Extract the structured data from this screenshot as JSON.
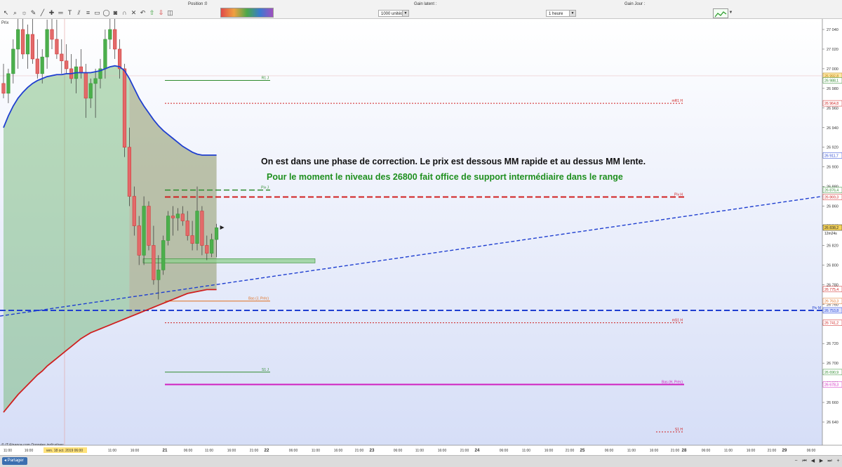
{
  "toolbar": {
    "position_label": "Position :",
    "position_value": "0",
    "latent_label": "Gain latent :",
    "gain_day_label": "Gain Jour :",
    "units_value": "1000 unités",
    "timeframe_value": "1 heure",
    "prix_label": "Prix"
  },
  "annotations": {
    "line1": "On est dans une phase de correction. Le prix est dessous MM rapide et au dessus MM lente.",
    "line2": "Pour le moment le niveau des 26800 fait office de support intermédiaire dans le range"
  },
  "copyright": "© IT-Finance.com Données indicatives",
  "status": {
    "share_label": "Partager"
  },
  "chart_data": {
    "type": "candlestick",
    "timeframe": "1 heure",
    "instrument_price": 26838.2,
    "timer": "12m24s",
    "y_axis": {
      "min": 26630,
      "max": 27050,
      "ticks": [
        27040,
        27020,
        27000,
        26980,
        26960,
        26940,
        26920,
        26900,
        26880,
        26860,
        26840,
        26820,
        26800,
        26780,
        26760,
        26740,
        26720,
        26700,
        26680,
        26660,
        26640
      ]
    },
    "x_axis_labels": [
      "11:00",
      "16:00",
      "ven. 18 oct. 2019 06:00",
      "11:00",
      "16:00",
      "21",
      "06:00",
      "11:00",
      "16:00",
      "21:00",
      "22",
      "06:00",
      "11:00",
      "16:00",
      "21:00",
      "23",
      "06:00",
      "11:00",
      "16:00",
      "21:00",
      "24",
      "06:00",
      "11:00",
      "16:00",
      "21:00",
      "25",
      "06:00",
      "11:00",
      "16:00",
      "21:00",
      "28",
      "06:00",
      "11:00",
      "16:00",
      "21:00",
      "29",
      "06:00"
    ],
    "price_tags": [
      {
        "value": 26992.8,
        "label": "26 992,8",
        "bg": "#ffe9a8",
        "fg": "#b07800"
      },
      {
        "value": 26988.1,
        "label": "26 988,1",
        "bg": "#ffffff",
        "fg": "#2e8b2e"
      },
      {
        "value": 26964.8,
        "label": "26 964,8",
        "bg": "#ffffff",
        "fg": "#d02020"
      },
      {
        "value": 26911.7,
        "label": "26 911,7",
        "bg": "#ffffff",
        "fg": "#1f3fd0"
      },
      {
        "value": 26876.4,
        "label": "26 876,4",
        "bg": "#ffffff",
        "fg": "#2e8b2e"
      },
      {
        "value": 26869.3,
        "label": "26 869,3",
        "bg": "#ffffff",
        "fg": "#d02020"
      },
      {
        "value": 26838.2,
        "label": "26 838,2",
        "bg": "#f5d35a",
        "fg": "#222222"
      },
      {
        "value": 26775.4,
        "label": "26 775,4",
        "bg": "#ffffff",
        "fg": "#d02020"
      },
      {
        "value": 26763.3,
        "label": "26 763,3",
        "bg": "#ffffff",
        "fg": "#e07020"
      },
      {
        "value": 26753.8,
        "label": "26 753,8",
        "bg": "#dde3ff",
        "fg": "#1f3fd0"
      },
      {
        "value": 26741.2,
        "label": "26 741,2",
        "bg": "#ffffff",
        "fg": "#d02020"
      },
      {
        "value": 26690.9,
        "label": "26 690,9",
        "bg": "#ffffff",
        "fg": "#2e8b2e"
      },
      {
        "value": 26678.3,
        "label": "26 678,3",
        "bg": "#ffffff",
        "fg": "#d020c0"
      }
    ],
    "levels": [
      {
        "name": "R1 J",
        "value": 26988.1,
        "color": "#2e8b2e",
        "style": "solid"
      },
      {
        "name": "mR1 H",
        "value": 26964.8,
        "color": "#d02020",
        "style": "dotted"
      },
      {
        "name": "Piv J",
        "value": 26876.4,
        "color": "#2e8b2e",
        "style": "dashed"
      },
      {
        "name": "Piv H",
        "value": 26869.3,
        "color": "#d02020",
        "style": "dashed"
      },
      {
        "name": "Bas (J, Préc)",
        "value": 26763.3,
        "color": "#e07020",
        "style": "solid"
      },
      {
        "name": "Piv M",
        "value": 26753.8,
        "color": "#1f3fd0",
        "style": "dashed"
      },
      {
        "name": "mS1 H",
        "value": 26741.2,
        "color": "#d02020",
        "style": "dotted"
      },
      {
        "name": "S1 J",
        "value": 26690.9,
        "color": "#2e8b2e",
        "style": "solid"
      },
      {
        "name": "Bas (H, Préc)",
        "value": 26678.3,
        "color": "#d020c0",
        "style": "solid"
      },
      {
        "name": "S1 H",
        "value": 26630,
        "color": "#d02020",
        "style": "dotted"
      }
    ],
    "support_zone": {
      "from": 26805,
      "to": 26801
    },
    "candles": [
      {
        "o": 26985,
        "h": 27005,
        "l": 26970,
        "c": 26975
      },
      {
        "o": 26975,
        "h": 27000,
        "l": 26965,
        "c": 26995
      },
      {
        "o": 26995,
        "h": 27030,
        "l": 26985,
        "c": 27020
      },
      {
        "o": 27020,
        "h": 27055,
        "l": 27000,
        "c": 27040
      },
      {
        "o": 27040,
        "h": 27060,
        "l": 27010,
        "c": 27015
      },
      {
        "o": 27015,
        "h": 27045,
        "l": 27000,
        "c": 27035
      },
      {
        "o": 27035,
        "h": 27065,
        "l": 27005,
        "c": 27010
      },
      {
        "o": 27010,
        "h": 27030,
        "l": 26990,
        "c": 26995
      },
      {
        "o": 26995,
        "h": 27020,
        "l": 26985,
        "c": 27012
      },
      {
        "o": 27012,
        "h": 27050,
        "l": 27000,
        "c": 27040
      },
      {
        "o": 27040,
        "h": 27055,
        "l": 27020,
        "c": 27030
      },
      {
        "o": 27030,
        "h": 27050,
        "l": 27010,
        "c": 27015
      },
      {
        "o": 27015,
        "h": 27030,
        "l": 26995,
        "c": 27008
      },
      {
        "o": 27008,
        "h": 27025,
        "l": 26995,
        "c": 27000
      },
      {
        "o": 27000,
        "h": 27015,
        "l": 26985,
        "c": 26990
      },
      {
        "o": 26990,
        "h": 27010,
        "l": 26975,
        "c": 27002
      },
      {
        "o": 27002,
        "h": 27020,
        "l": 26990,
        "c": 26996
      },
      {
        "o": 26996,
        "h": 27005,
        "l": 26950,
        "c": 26970
      },
      {
        "o": 26970,
        "h": 26990,
        "l": 26960,
        "c": 26985
      },
      {
        "o": 26985,
        "h": 27000,
        "l": 26950,
        "c": 26990
      },
      {
        "o": 26990,
        "h": 27010,
        "l": 26980,
        "c": 27000
      },
      {
        "o": 27000,
        "h": 27040,
        "l": 26990,
        "c": 27030
      },
      {
        "o": 27030,
        "h": 27055,
        "l": 27020,
        "c": 27040
      },
      {
        "o": 27040,
        "h": 27060,
        "l": 27010,
        "c": 27020
      },
      {
        "o": 27020,
        "h": 27030,
        "l": 26990,
        "c": 27000
      },
      {
        "o": 27000,
        "h": 27005,
        "l": 26910,
        "c": 26920
      },
      {
        "o": 26920,
        "h": 26940,
        "l": 26860,
        "c": 26870
      },
      {
        "o": 26870,
        "h": 26880,
        "l": 26830,
        "c": 26840
      },
      {
        "o": 26840,
        "h": 26850,
        "l": 26800,
        "c": 26810
      },
      {
        "o": 26810,
        "h": 26870,
        "l": 26800,
        "c": 26860
      },
      {
        "o": 26860,
        "h": 26865,
        "l": 26815,
        "c": 26820
      },
      {
        "o": 26820,
        "h": 26840,
        "l": 26780,
        "c": 26785
      },
      {
        "o": 26785,
        "h": 26810,
        "l": 26765,
        "c": 26795
      },
      {
        "o": 26795,
        "h": 26830,
        "l": 26790,
        "c": 26825
      },
      {
        "o": 26825,
        "h": 26855,
        "l": 26820,
        "c": 26850
      },
      {
        "o": 26850,
        "h": 26860,
        "l": 26830,
        "c": 26848
      },
      {
        "o": 26848,
        "h": 26858,
        "l": 26835,
        "c": 26852
      },
      {
        "o": 26852,
        "h": 26860,
        "l": 26840,
        "c": 26845
      },
      {
        "o": 26845,
        "h": 26855,
        "l": 26825,
        "c": 26830
      },
      {
        "o": 26830,
        "h": 26845,
        "l": 26815,
        "c": 26822
      },
      {
        "o": 26822,
        "h": 26880,
        "l": 26815,
        "c": 26855
      },
      {
        "o": 26855,
        "h": 26860,
        "l": 26810,
        "c": 26820
      },
      {
        "o": 26820,
        "h": 26830,
        "l": 26805,
        "c": 26812
      },
      {
        "o": 26812,
        "h": 26832,
        "l": 26808,
        "c": 26826
      },
      {
        "o": 26826,
        "h": 26842,
        "l": 26808,
        "c": 26838
      }
    ],
    "moving_averages": [
      {
        "name": "MM rapide",
        "color": "#1f3fd0",
        "values": [
          26940,
          26952,
          26962,
          26970,
          26976,
          26981,
          26985,
          26988,
          26990,
          26992,
          26993,
          26994,
          26994,
          26995,
          26995,
          26996,
          26996,
          26996,
          26996,
          26997,
          26998,
          27000,
          27002,
          27003,
          27002,
          26998,
          26990,
          26980,
          26970,
          26962,
          26955,
          26948,
          26942,
          26937,
          26933,
          26929,
          26925,
          26921,
          26918,
          26915,
          26913,
          26912,
          26912,
          26912,
          26912
        ]
      },
      {
        "name": "MM lente",
        "color": "#d02020",
        "values": [
          26650,
          26656,
          26662,
          26668,
          26673,
          26678,
          26683,
          26688,
          26692,
          26697,
          26701,
          26705,
          26709,
          26713,
          26717,
          26721,
          26725,
          26728,
          26731,
          26733,
          26735,
          26737,
          26739,
          26741,
          26743,
          26745,
          26747,
          26749,
          26751,
          26753,
          26755,
          26757,
          26759,
          26761,
          26763,
          26765,
          26767,
          26769,
          26771,
          26772,
          26773,
          26774,
          26775,
          26775,
          26775
        ]
      }
    ],
    "trendline": {
      "color": "#1f3fd0",
      "from": 26748,
      "to": 26870
    }
  }
}
